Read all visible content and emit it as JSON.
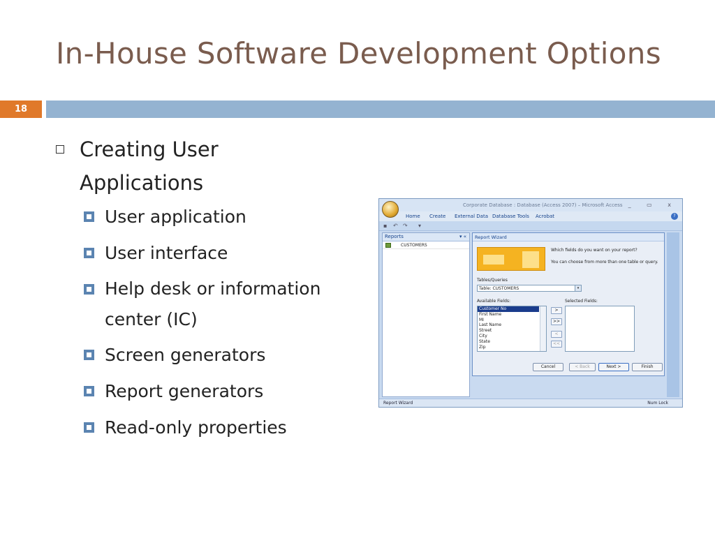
{
  "slide": {
    "title": "In-House Software Development Options",
    "number": "18",
    "bullet_main": "Creating User Applications",
    "sub_bullets": [
      "User application",
      "User interface",
      "Help desk or information center (IC)",
      "Screen generators",
      "Report generators",
      "Read-only properties"
    ]
  },
  "access": {
    "window_title": "Corporate Database : Database (Access 2007) – Microsoft Access",
    "window_controls": "_ ▭ x",
    "tabs": [
      "Home",
      "Create",
      "External Data",
      "Database Tools",
      "Acrobat"
    ],
    "nav_header": "Reports",
    "nav_arrows": "▾ «",
    "nav_item": "CUSTOMERS",
    "wizard_title": "Report Wizard",
    "question": "Which fields do you want on your report?",
    "hint": "You can choose from more than one table or query.",
    "tables_label": "Tables/Queries",
    "table_value": "Table: CUSTOMERS",
    "available_label": "Available Fields:",
    "selected_label": "Selected Fields:",
    "fields": [
      "Customer No",
      "First Name",
      "MI",
      "Last Name",
      "Street",
      "City",
      "State",
      "Zip"
    ],
    "move_buttons": [
      ">",
      ">>",
      "<",
      "<<"
    ],
    "cancel": "Cancel",
    "back": "< Back",
    "next": "Next >",
    "finish": "Finish",
    "status_left": "Report Wizard",
    "status_right": "Num Lock"
  },
  "colors": {
    "title": "#7a5c4e",
    "accent_orange": "#e0792a",
    "bar_blue": "#94b3d1",
    "bullet_blue": "#5b84b1"
  }
}
